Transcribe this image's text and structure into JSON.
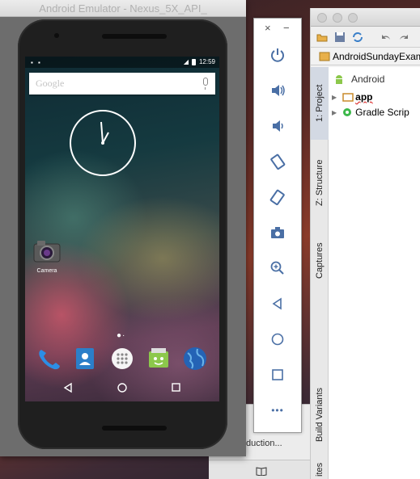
{
  "emulator": {
    "title": "Android Emulator - Nexus_5X_API_",
    "status_bar": {
      "time": "12:59"
    },
    "search": {
      "logo_text": "Google"
    },
    "home": {
      "apps": [
        {
          "label": "Camera"
        }
      ],
      "dock": [
        "phone-icon",
        "contacts-icon",
        "app-drawer-icon",
        "messaging-icon",
        "browser-icon"
      ]
    }
  },
  "emulator_toolbar": {
    "close": "×",
    "minimize": "−",
    "more": "•••",
    "buttons": [
      "power-icon",
      "volume-up-icon",
      "volume-down-icon",
      "rotate-left-icon",
      "rotate-right-icon",
      "screenshot-icon",
      "zoom-icon",
      "back-icon",
      "home-icon",
      "overview-icon"
    ]
  },
  "studio": {
    "project_name": "AndroidSundayExam",
    "view_selector": "Android",
    "tree": [
      {
        "label": "app"
      },
      {
        "label": "Gradle Scrip"
      }
    ],
    "side_tabs": {
      "project": "1: Project",
      "structure": "Z: Structure",
      "captures": "Captures",
      "build_variants": "Build Variants",
      "favorites": "ites"
    }
  },
  "behind_window": {
    "text": "duction..."
  },
  "colors": {
    "toolbar_accent": "#4a6fa5",
    "android_green": "#8cc84b"
  }
}
